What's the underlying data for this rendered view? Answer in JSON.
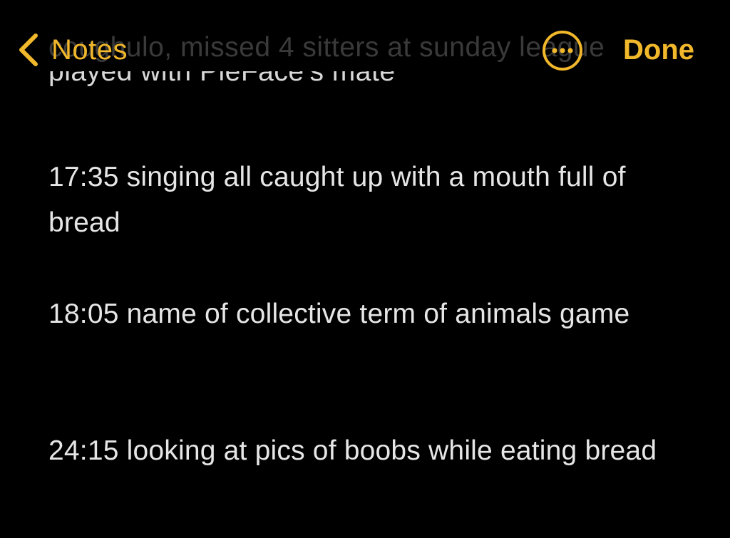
{
  "nav": {
    "back_label": "Notes",
    "done_label": "Done",
    "more_icon": "ellipsis-circle-icon",
    "back_icon": "chevron-left-icon",
    "accent_color": "#f2b82b"
  },
  "note": {
    "scrolled_line_1": "coughulo, missed 4 sitters at sunday league",
    "scrolled_line_2": "played with PieFace's mate",
    "entries": [
      {
        "text": "17:35 singing all caught up with a mouth full of bread"
      },
      {
        "text": "18:05 name of collective term of animals game"
      },
      {
        "text": "24:15 looking at pics of boobs while eating bread"
      }
    ]
  }
}
